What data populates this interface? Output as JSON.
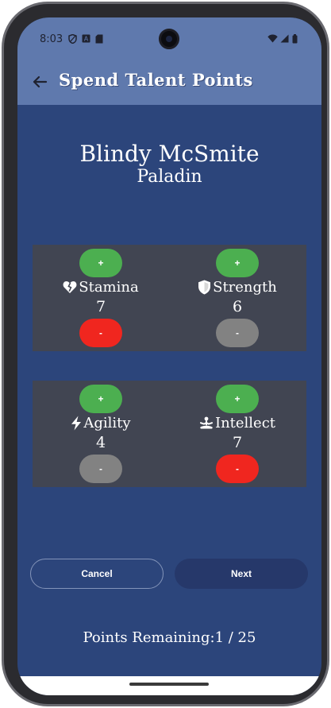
{
  "status_bar": {
    "time": "8:03",
    "left_icons": [
      "shield-icon",
      "accessibility-icon",
      "sd-card-icon"
    ],
    "right_icons": [
      "wifi-icon",
      "signal-icon",
      "battery-icon"
    ]
  },
  "app_bar": {
    "title": "Spend Talent Points",
    "back_icon": "arrow-left-icon"
  },
  "hero": {
    "name": "Blindy McSmite",
    "class": "Paladin"
  },
  "stats": [
    {
      "name": "Stamina",
      "value": "7",
      "icon": "broken-heart-icon",
      "plus_label": "+",
      "minus_label": "-",
      "minus_state": "red"
    },
    {
      "name": "Strength",
      "value": "6",
      "icon": "shield-icon",
      "plus_label": "+",
      "minus_label": "-",
      "minus_state": "grey"
    },
    {
      "name": "Agility",
      "value": "4",
      "icon": "lightning-icon",
      "plus_label": "+",
      "minus_label": "-",
      "minus_state": "grey"
    },
    {
      "name": "Intellect",
      "value": "7",
      "icon": "meditation-icon",
      "plus_label": "+",
      "minus_label": "-",
      "minus_state": "red"
    }
  ],
  "actions": {
    "cancel_label": "Cancel",
    "next_label": "Next"
  },
  "footer": {
    "points_remaining": "Points Remaining:1 / 25"
  },
  "colors": {
    "background": "#2c457b",
    "app_bar": "#5f79ad",
    "panel": "#414552",
    "plus_button": "#4caf50",
    "minus_active": "#f0261f",
    "minus_disabled": "#828282",
    "next_button": "#26386a"
  }
}
